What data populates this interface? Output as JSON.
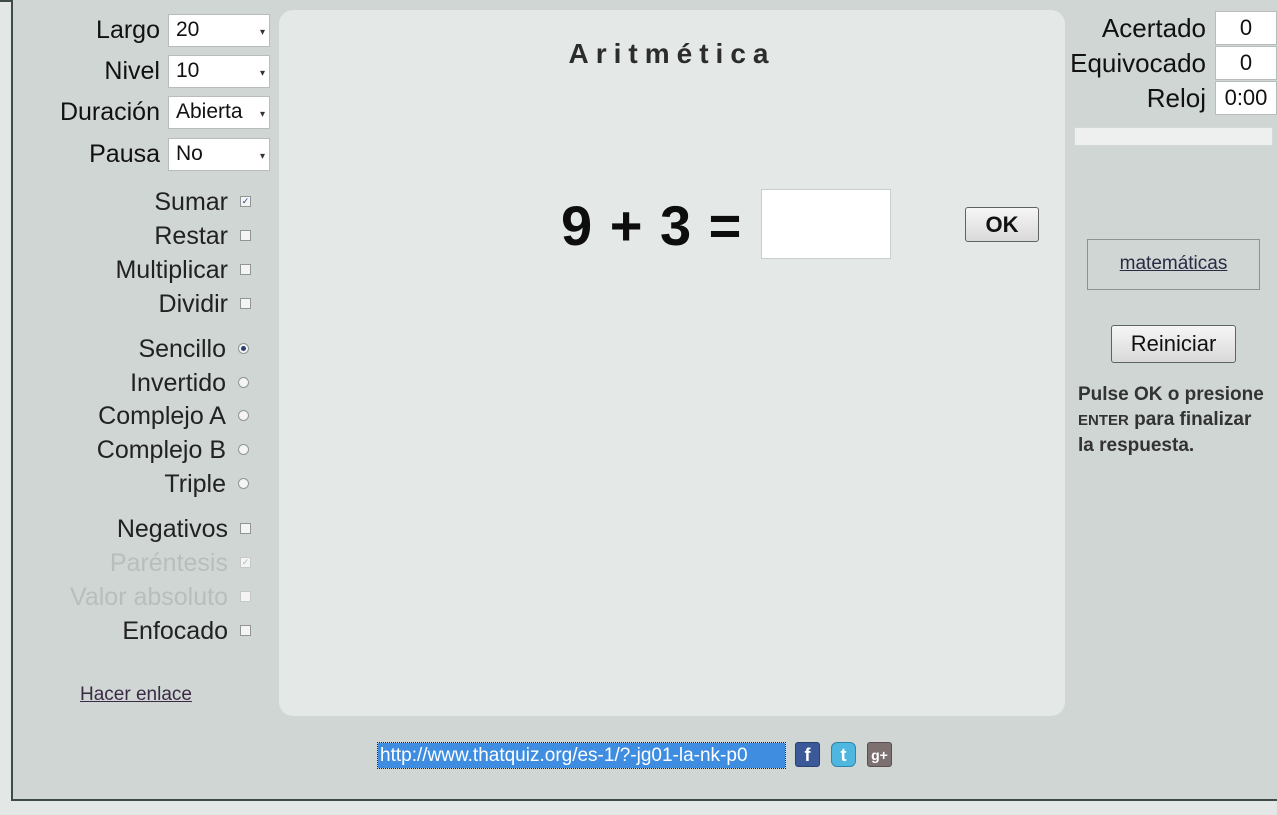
{
  "settings": [
    {
      "label": "Largo",
      "value": "20"
    },
    {
      "label": "Nivel",
      "value": "10"
    },
    {
      "label": "Duración",
      "value": "Abierta"
    },
    {
      "label": "Pausa",
      "value": "No"
    }
  ],
  "operations": [
    {
      "label": "Sumar",
      "checked": true
    },
    {
      "label": "Restar",
      "checked": false
    },
    {
      "label": "Multiplicar",
      "checked": false
    },
    {
      "label": "Dividir",
      "checked": false
    }
  ],
  "formats": [
    {
      "label": "Sencillo",
      "selected": true
    },
    {
      "label": "Invertido",
      "selected": false
    },
    {
      "label": "Complejo A",
      "selected": false
    },
    {
      "label": "Complejo B",
      "selected": false
    },
    {
      "label": "Triple",
      "selected": false
    }
  ],
  "extras": [
    {
      "label": "Negativos",
      "checked": false,
      "disabled": false
    },
    {
      "label": "Paréntesis",
      "checked": true,
      "disabled": true
    },
    {
      "label": "Valor absoluto",
      "checked": false,
      "disabled": true
    },
    {
      "label": "Enfocado",
      "checked": false,
      "disabled": false
    }
  ],
  "link_left": "Hacer enlace",
  "quiz": {
    "title": "Aritmética",
    "problem": "9 + 3 =",
    "answer": "",
    "ok_label": "OK"
  },
  "score": {
    "correct_label": "Acertado",
    "correct_value": "0",
    "wrong_label": "Equivocado",
    "wrong_value": "0",
    "clock_label": "Reloj",
    "clock_value": "0:00",
    "progress_fraction": 0
  },
  "math_link": "matemáticas",
  "reset_label": "Reiniciar",
  "hint": {
    "part1": "Pulse OK o presione ",
    "key": "ENTER",
    "part2": " para finalizar la respuesta."
  },
  "share": {
    "url": "http://www.thatquiz.org/es-1/?-jg01-la-nk-p0",
    "icons": [
      "facebook-icon",
      "twitter-icon",
      "google-plus-icon"
    ],
    "facebook_glyph": "f",
    "twitter_glyph": "t",
    "google_glyph": "g+"
  },
  "colors": {
    "background": "#cfd6d4",
    "panel": "#e4e8e6",
    "url_highlight": "#3e8de0"
  }
}
